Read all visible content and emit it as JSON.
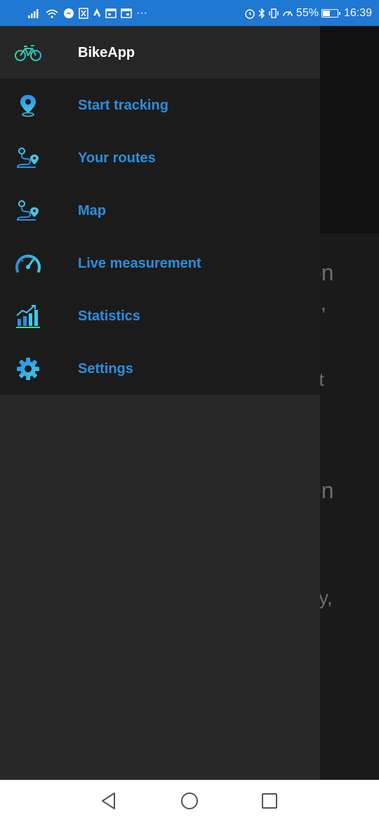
{
  "status_bar": {
    "battery_percent": "55%",
    "battery_level": 0.55,
    "time": "16:39",
    "more_indicator": "···"
  },
  "drawer": {
    "app_title": "BikeApp",
    "items": [
      {
        "label": "Start tracking",
        "icon": "location-pin-icon"
      },
      {
        "label": "Your routes",
        "icon": "route-icon"
      },
      {
        "label": "Map",
        "icon": "map-route-icon"
      },
      {
        "label": "Live measurement",
        "icon": "speedometer-icon"
      },
      {
        "label": "Statistics",
        "icon": "bar-chart-icon"
      },
      {
        "label": "Settings",
        "icon": "gear-icon"
      }
    ]
  },
  "background_fragments": [
    "on",
    "e,",
    "et",
    "en",
    "ity,"
  ],
  "colors": {
    "status_bar": "#1f78d1",
    "accent": "#2a8fe0",
    "icon_gradient_start": "#3ec8e8",
    "icon_gradient_end": "#2a7fe0",
    "drawer_bg": "#282828",
    "menu_bg": "#1b1b1b"
  }
}
